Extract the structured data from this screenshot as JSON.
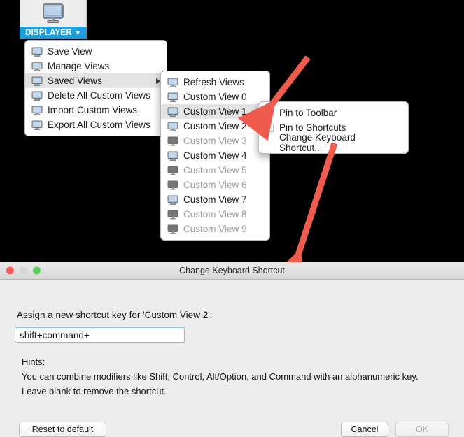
{
  "toolbar": {
    "icon": "monitor-icon",
    "label": "DISPLAYER",
    "caret": "▼"
  },
  "main_menu": {
    "items": [
      {
        "label": "Save View",
        "icon": "monitor-icon",
        "state": "normal",
        "submenu": false
      },
      {
        "label": "Manage Views",
        "icon": "monitor-icon",
        "state": "normal",
        "submenu": false
      },
      {
        "label": "Saved Views",
        "icon": "monitor-icon",
        "state": "selected",
        "submenu": true
      },
      {
        "label": "Delete All Custom Views",
        "icon": "monitor-icon",
        "state": "normal",
        "submenu": false
      },
      {
        "label": "Import Custom Views",
        "icon": "monitor-icon",
        "state": "normal",
        "submenu": false
      },
      {
        "label": "Export All Custom Views",
        "icon": "monitor-icon",
        "state": "normal",
        "submenu": false
      }
    ]
  },
  "saved_views_submenu": {
    "items": [
      {
        "label": "Refresh Views",
        "icon": "monitor-icon",
        "state": "normal",
        "kebab": false
      },
      {
        "label": "Custom View 0",
        "icon": "monitor-icon",
        "state": "normal",
        "kebab": false
      },
      {
        "label": "Custom View 1",
        "icon": "monitor-icon",
        "state": "selected",
        "kebab": true
      },
      {
        "label": "Custom View 2",
        "icon": "monitor-icon",
        "state": "normal",
        "kebab": false
      },
      {
        "label": "Custom View 3",
        "icon": "monitor-icon",
        "state": "disabled",
        "kebab": false
      },
      {
        "label": "Custom View 4",
        "icon": "monitor-icon",
        "state": "normal",
        "kebab": false
      },
      {
        "label": "Custom View 5",
        "icon": "monitor-icon",
        "state": "disabled",
        "kebab": false
      },
      {
        "label": "Custom View 6",
        "icon": "monitor-icon",
        "state": "disabled",
        "kebab": false
      },
      {
        "label": "Custom View 7",
        "icon": "monitor-icon",
        "state": "normal",
        "kebab": false
      },
      {
        "label": "Custom View 8",
        "icon": "monitor-icon",
        "state": "disabled",
        "kebab": false
      },
      {
        "label": "Custom View 9",
        "icon": "monitor-icon",
        "state": "disabled",
        "kebab": false
      }
    ]
  },
  "context_menu": {
    "items": [
      {
        "label": "Pin to Toolbar",
        "type": "checkbox",
        "checked": false
      },
      {
        "label": "Pin to Shortcuts",
        "type": "checkbox",
        "checked": false
      },
      {
        "label": "Change Keyboard Shortcut...",
        "type": "command"
      }
    ]
  },
  "dialog": {
    "title": "Change Keyboard Shortcut",
    "traffic_lights": {
      "close": "close-button",
      "minimize": "minimize-button",
      "zoom": "zoom-button"
    },
    "assign_label": "Assign a new shortcut key for 'Custom View 2':",
    "shortcut_value": "shift+command+",
    "shortcut_placeholder": "",
    "hints_title": "Hints:",
    "hint_line_1": "You can combine modifiers like Shift, Control, Alt/Option, and Command with an alphanumeric key.",
    "hint_line_2": "Leave blank to remove the shortcut.",
    "buttons": {
      "reset": "Reset to default",
      "cancel": "Cancel",
      "ok": "OK"
    }
  },
  "annotations": {
    "arrow_color": "#ef5b4c",
    "arrow_1_target": "Custom View 1",
    "arrow_2_target": "Change Keyboard Shortcut"
  }
}
